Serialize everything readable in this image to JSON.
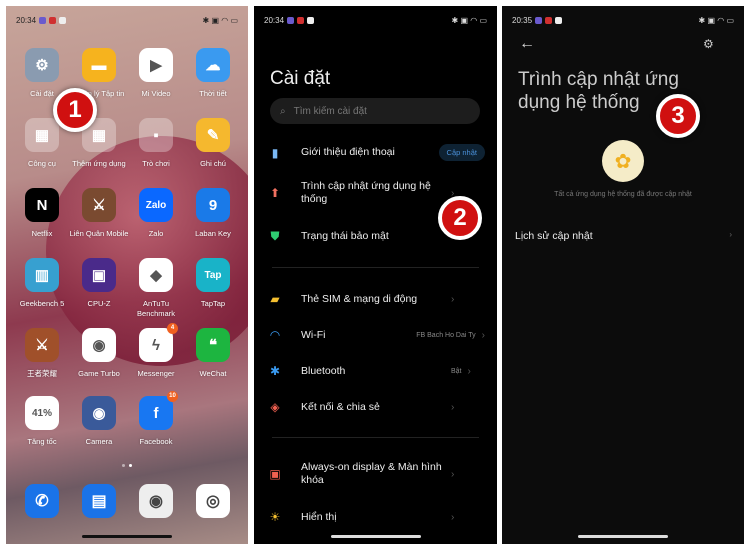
{
  "home": {
    "time": "20:34",
    "apps": [
      {
        "label": "Cài đặt",
        "color": "#8a9bb0",
        "glyph": "⚙"
      },
      {
        "label": "Quản lý Tập tin",
        "color": "#f6b31e",
        "glyph": "▬"
      },
      {
        "label": "Mi Video",
        "color": "#ffffff",
        "glyph": "▶"
      },
      {
        "label": "Thời tiết",
        "color": "#3a9af0",
        "glyph": "☁"
      },
      {
        "label": "Công cụ",
        "color": "rgba(255,255,255,0.3)",
        "glyph": "▦"
      },
      {
        "label": "Thêm ứng dụng",
        "color": "rgba(255,255,255,0.3)",
        "glyph": "▦"
      },
      {
        "label": "Trò chơi",
        "color": "rgba(255,255,255,0.3)",
        "glyph": "▪"
      },
      {
        "label": "Ghi chú",
        "color": "#f5b82e",
        "glyph": "✎"
      },
      {
        "label": "Netflix",
        "color": "#000000",
        "glyph": "N"
      },
      {
        "label": "Liên Quân Mobile",
        "color": "#7a4a30",
        "glyph": "⚔"
      },
      {
        "label": "Zalo",
        "color": "#0a68ff",
        "glyph": "Zalo"
      },
      {
        "label": "Laban Key",
        "color": "#1a7ae8",
        "glyph": "9"
      },
      {
        "label": "Geekbench 5",
        "color": "#37a0d0",
        "glyph": "▥"
      },
      {
        "label": "CPU-Z",
        "color": "#4a2a8a",
        "glyph": "▣"
      },
      {
        "label": "AnTuTu Benchmark",
        "color": "#ffffff",
        "glyph": "◆"
      },
      {
        "label": "TapTap",
        "color": "#19b3c8",
        "glyph": "Tap"
      },
      {
        "label": "王者荣耀",
        "color": "#a0502a",
        "glyph": "⚔"
      },
      {
        "label": "Game Turbo",
        "color": "#ffffff",
        "glyph": "◉"
      },
      {
        "label": "Messenger",
        "color": "#ffffff",
        "glyph": "ϟ",
        "badge": "4"
      },
      {
        "label": "WeChat",
        "color": "#1db540",
        "glyph": "❝"
      },
      {
        "label": "Tăng tốc",
        "color": "#ffffff",
        "glyph": "41%"
      },
      {
        "label": "Camera",
        "color": "#3a5a9a",
        "glyph": "◉"
      },
      {
        "label": "Facebook",
        "color": "#1877f2",
        "glyph": "f",
        "badge": "10"
      }
    ],
    "dock": [
      {
        "name": "phone",
        "color": "#1a73e8",
        "glyph": "✆"
      },
      {
        "name": "messages",
        "color": "#1a73e8",
        "glyph": "▤"
      },
      {
        "name": "camera",
        "color": "#eeeeee",
        "glyph": "◉"
      },
      {
        "name": "chrome",
        "color": "#ffffff",
        "glyph": "◎"
      }
    ]
  },
  "settings": {
    "time": "20:34",
    "title": "Cài đặt",
    "search_placeholder": "Tìm kiếm cài đặt",
    "items": [
      {
        "label": "Giới thiệu điện thoại",
        "badge": "Cập nhật",
        "icon": "phone-icon",
        "color": "#7ab8f5",
        "glyph": "▮"
      },
      {
        "label": "Trình cập nhật ứng dụng hệ thống",
        "icon": "arrow-up-icon",
        "color": "#f07060",
        "glyph": "⬆"
      },
      {
        "label": "Trạng thái bảo mật",
        "icon": "shield-icon",
        "color": "#2ecc71",
        "glyph": "⛊"
      },
      {
        "label": "Thẻ SIM & mạng di động",
        "icon": "sim-icon",
        "color": "#f5c030",
        "glyph": "▰"
      },
      {
        "label": "Wi-Fi",
        "value": "FB Bach Ho Dai Ty",
        "icon": "wifi-icon",
        "color": "#3a9af0",
        "glyph": "◠"
      },
      {
        "label": "Bluetooth",
        "value": "Bật",
        "icon": "bluetooth-icon",
        "color": "#3a9af0",
        "glyph": "✱"
      },
      {
        "label": "Kết nối & chia sẻ",
        "icon": "share-icon",
        "color": "#f06050",
        "glyph": "◈"
      },
      {
        "label": "Always-on display & Màn hình khóa",
        "icon": "lock-icon",
        "color": "#f06050",
        "glyph": "▣"
      },
      {
        "label": "Hiển thị",
        "icon": "sun-icon",
        "color": "#f5c030",
        "glyph": "☀"
      }
    ]
  },
  "updater": {
    "time": "20:35",
    "title": "Trình cập nhật ứng dụng hệ thống",
    "status": "Tất cả ứng dụng hệ thống đã được cập nhật",
    "history": "Lịch sử cập nhật"
  },
  "steps": [
    "1",
    "2",
    "3"
  ]
}
